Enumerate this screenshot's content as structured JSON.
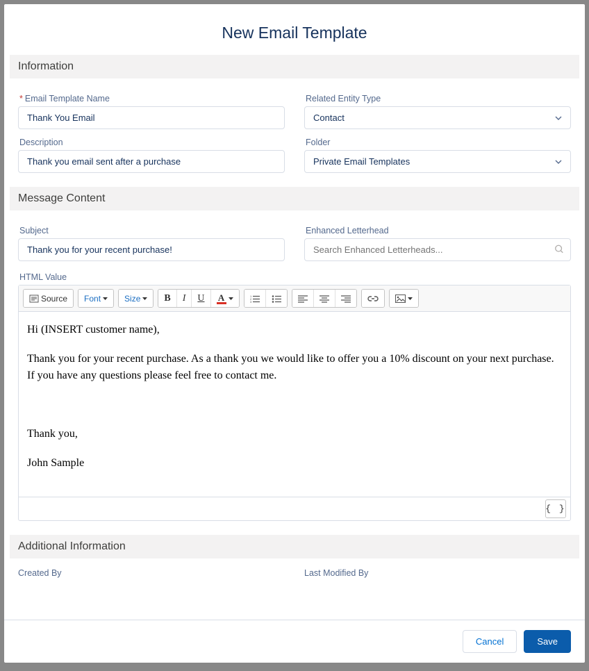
{
  "modal": {
    "title": "New Email Template"
  },
  "sections": {
    "information": "Information",
    "message_content": "Message Content",
    "additional_information": "Additional Information"
  },
  "fields": {
    "template_name": {
      "label": "Email Template Name",
      "value": "Thank You Email"
    },
    "related_entity": {
      "label": "Related Entity Type",
      "value": "Contact"
    },
    "description": {
      "label": "Description",
      "value": "Thank you email sent after a purchase"
    },
    "folder": {
      "label": "Folder",
      "value": "Private Email Templates"
    },
    "subject": {
      "label": "Subject",
      "value": "Thank you for your recent purchase!"
    },
    "enhanced_letterhead": {
      "label": "Enhanced Letterhead",
      "placeholder": "Search Enhanced Letterheads..."
    },
    "html_value": {
      "label": "HTML Value"
    },
    "created_by": {
      "label": "Created By"
    },
    "last_modified_by": {
      "label": "Last Modified By"
    }
  },
  "toolbar": {
    "source": "Source",
    "font": "Font",
    "size": "Size"
  },
  "editor_body": {
    "line1": "Hi (INSERT customer name),",
    "line2": "Thank you for your recent purchase. As a thank you we would like to offer you a 10% discount on your next purchase. If you have any questions please feel free to contact me.",
    "line3": "Thank you,",
    "line4": "John Sample"
  },
  "footer": {
    "cancel": "Cancel",
    "save": "Save"
  }
}
